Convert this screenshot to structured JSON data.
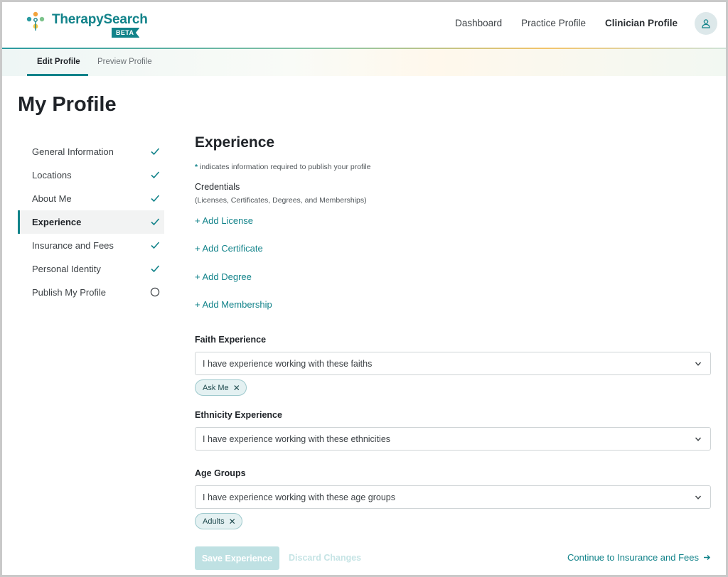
{
  "header": {
    "brand": "TherapySearch",
    "badge": "BETA",
    "nav": [
      "Dashboard",
      "Practice Profile",
      "Clinician Profile"
    ],
    "active_nav": "Clinician Profile",
    "avatar_icon": "user-icon"
  },
  "subnav": {
    "tabs": [
      "Edit Profile",
      "Preview Profile"
    ],
    "active_tab": "Edit Profile"
  },
  "page": {
    "title": "My Profile"
  },
  "sidebar": {
    "items": [
      {
        "label": "General Information",
        "status": "complete"
      },
      {
        "label": "Locations",
        "status": "complete"
      },
      {
        "label": "About Me",
        "status": "complete"
      },
      {
        "label": "Experience",
        "status": "complete",
        "active": true
      },
      {
        "label": "Insurance and Fees",
        "status": "complete"
      },
      {
        "label": "Personal Identity",
        "status": "complete"
      },
      {
        "label": "Publish My Profile",
        "status": "incomplete"
      }
    ]
  },
  "main": {
    "heading": "Experience",
    "required_star": "*",
    "required_note": " indicates information required to publish your profile",
    "credentials_title": "Credentials",
    "credentials_sub": "(Licenses, Certificates, Degrees, and Memberships)",
    "add_links": [
      "+ Add License",
      "+ Add Certificate",
      "+ Add Degree",
      "+ Add Membership"
    ],
    "faith": {
      "label": "Faith Experience",
      "placeholder": "I have experience working with these faiths",
      "chips": [
        "Ask Me"
      ]
    },
    "ethnicity": {
      "label": "Ethnicity Experience",
      "placeholder": "I have experience working with these ethnicities",
      "chips": []
    },
    "age": {
      "label": "Age Groups",
      "placeholder": "I have experience working with these age groups",
      "chips": [
        "Adults"
      ]
    },
    "save_label": "Save Experience",
    "discard_label": "Discard Changes",
    "continue_label": "Continue to Insurance and Fees"
  },
  "colors": {
    "accent": "#12838a",
    "chip_bg": "#e4f1f2",
    "disabled_btn": "#bfe1e3"
  }
}
